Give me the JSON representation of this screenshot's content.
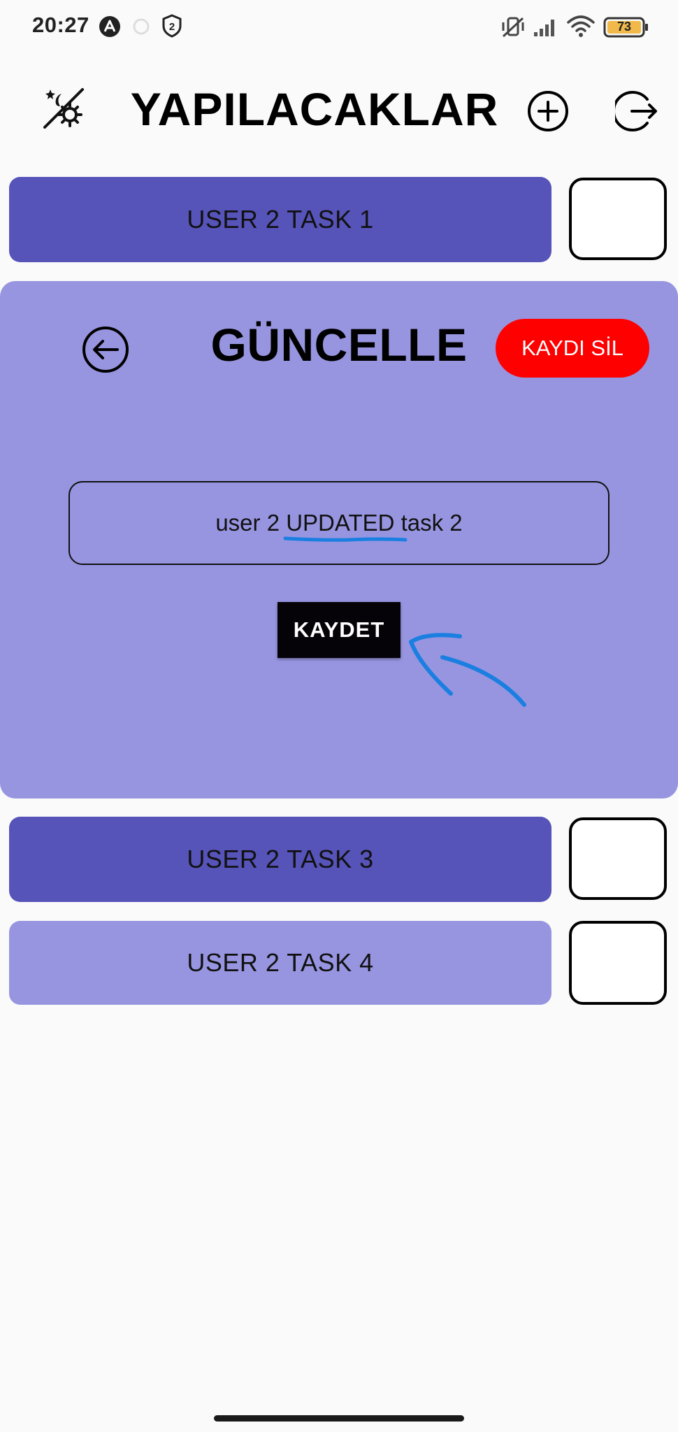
{
  "status_bar": {
    "time": "20:27",
    "battery": "73",
    "icons": [
      "notification-a-icon",
      "circle-loading-icon",
      "shield-2-icon",
      "vibrate-off-icon",
      "signal-icon",
      "wifi-icon",
      "battery-icon"
    ],
    "shield_badge": "2"
  },
  "header": {
    "title": "YAPILACAKLAR",
    "left_icon": "theme-toggle-icon",
    "right_icons": [
      "add-circle-icon",
      "logout-icon"
    ]
  },
  "tasks": [
    {
      "label": "USER 2 TASK 1",
      "color": "#5653b9"
    },
    {
      "label": "USER 2 TASK 3",
      "color": "#5653b9"
    },
    {
      "label": "USER 2 TASK 4",
      "color": "#9795e0"
    }
  ],
  "edit_panel": {
    "title": "GÜNCELLE",
    "delete_label": "KAYDI SİL",
    "input_value": "user 2 UPDATED task 2",
    "save_label": "KAYDET",
    "back_icon": "arrow-left-circle-icon"
  },
  "colors": {
    "panel_bg": "#9795e0",
    "task_dark": "#5653b9",
    "task_light": "#9795e0",
    "delete_red": "#ff0000",
    "save_black": "#050308",
    "annotation_blue": "#1a7fe0"
  }
}
